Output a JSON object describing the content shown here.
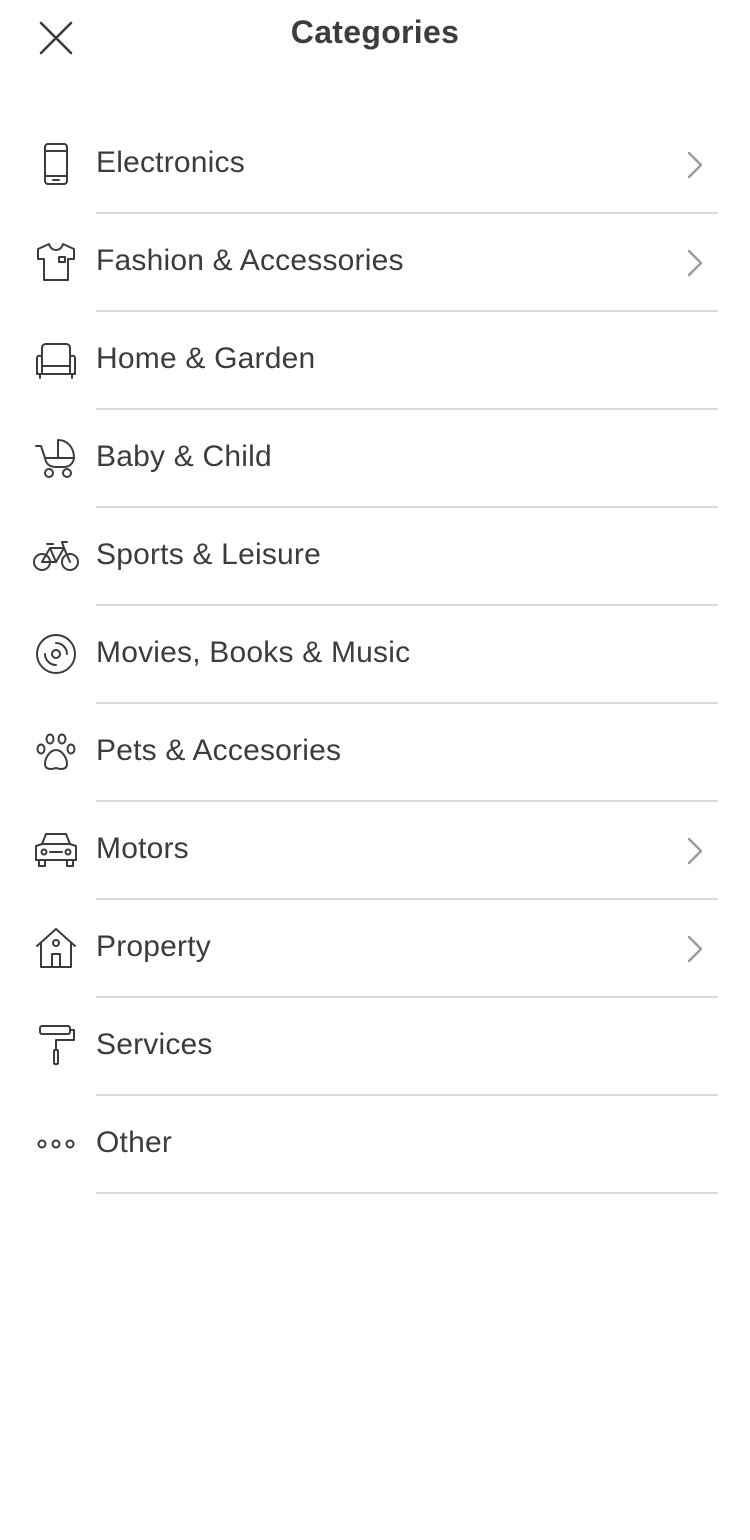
{
  "header": {
    "title": "Categories",
    "close_icon": "close-icon"
  },
  "categories": [
    {
      "label": "Electronics",
      "icon": "smartphone-icon",
      "has_children": true
    },
    {
      "label": "Fashion & Accessories",
      "icon": "tshirt-icon",
      "has_children": true
    },
    {
      "label": "Home & Garden",
      "icon": "sofa-icon",
      "has_children": false
    },
    {
      "label": "Baby & Child",
      "icon": "stroller-icon",
      "has_children": false
    },
    {
      "label": "Sports & Leisure",
      "icon": "bicycle-icon",
      "has_children": false
    },
    {
      "label": "Movies, Books & Music",
      "icon": "disc-icon",
      "has_children": false
    },
    {
      "label": "Pets & Accesories",
      "icon": "paw-icon",
      "has_children": false
    },
    {
      "label": "Motors",
      "icon": "car-icon",
      "has_children": true
    },
    {
      "label": "Property",
      "icon": "house-icon",
      "has_children": true
    },
    {
      "label": "Services",
      "icon": "paint-roller-icon",
      "has_children": false
    },
    {
      "label": "Other",
      "icon": "more-dots-icon",
      "has_children": false
    }
  ],
  "colors": {
    "text": "#3c3c3c",
    "divider": "#d9d9d9",
    "chevron": "#9a9a9a",
    "background": "#ffffff"
  }
}
